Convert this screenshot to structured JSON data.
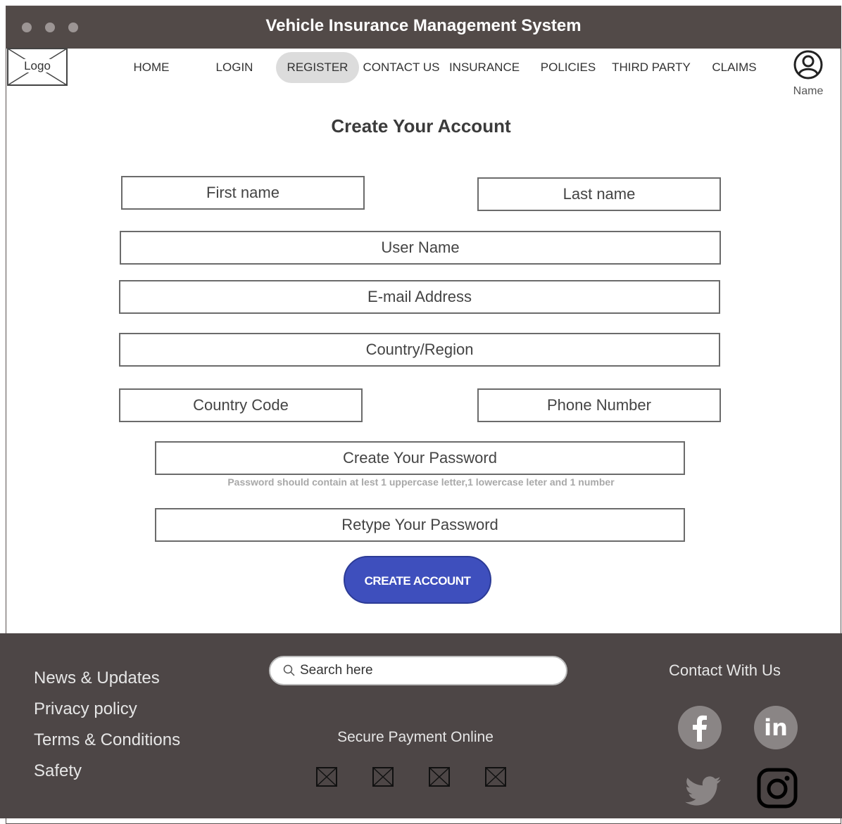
{
  "window": {
    "title": "Vehicle Insurance Management System"
  },
  "header": {
    "logo_label": "Logo",
    "nav": [
      {
        "label": "HOME",
        "active": false
      },
      {
        "label": "LOGIN",
        "active": false
      },
      {
        "label": "REGISTER",
        "active": true
      },
      {
        "label": "CONTACT US",
        "active": false
      },
      {
        "label": "INSURANCE",
        "active": false
      },
      {
        "label": "POLICIES",
        "active": false
      },
      {
        "label": "THIRD PARTY",
        "active": false
      },
      {
        "label": "CLAIMS",
        "active": false
      }
    ],
    "profile_label": "Name"
  },
  "form": {
    "heading": "Create Your Account",
    "first_name": "First name",
    "last_name": "Last name",
    "user_name": "User Name",
    "email": "E-mail Address",
    "country_region": "Country/Region",
    "country_code": "Country Code",
    "phone_number": "Phone Number",
    "create_password": "Create Your Password",
    "password_hint": "Password should contain at lest 1 uppercase letter,1 lowercase leter and 1 number",
    "retype_password": "Retype Your Password",
    "submit_label": "CREATE ACCOUNT",
    "submit_color": "#3e4fbd"
  },
  "footer": {
    "links": [
      "News & Updates",
      "Privacy policy",
      "Terms & Conditions",
      "Safety"
    ],
    "search_placeholder": "Search here",
    "secure_payment_label": "Secure Payment Online",
    "payment_icons": [
      "image-placeholder-icon",
      "image-placeholder-icon",
      "image-placeholder-icon",
      "image-placeholder-icon"
    ],
    "contact_title": "Contact With Us",
    "social_icons": [
      "facebook-icon",
      "linkedin-icon",
      "twitter-icon",
      "instagram-icon"
    ],
    "background": "#4d4646"
  }
}
